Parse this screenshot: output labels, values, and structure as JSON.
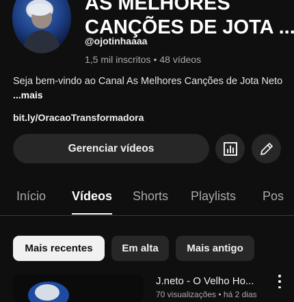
{
  "channel": {
    "title_line1": "AS MELHORES",
    "title_line2": "CANÇÕES DE JOTA ...",
    "handle": "@ojotinhaaaa",
    "subscribers": "1,5 mil inscritos",
    "separator": "•",
    "video_count": "48 vídeos",
    "description": "Seja bem-vindo ao Canal As Melhores Canções de Jota Neto",
    "more_label": "...mais",
    "link": "bit.ly/OracaoTransformadora"
  },
  "actions": {
    "manage_label": "Gerenciar vídeos",
    "analytics_icon": "analytics-icon",
    "edit_icon": "pencil-icon"
  },
  "tabs": [
    {
      "label": "Início"
    },
    {
      "label": "Vídeos",
      "active": true
    },
    {
      "label": "Shorts"
    },
    {
      "label": "Playlists"
    },
    {
      "label": "Pos"
    }
  ],
  "chips": [
    {
      "label": "Mais recentes",
      "selected": true
    },
    {
      "label": "Em alta"
    },
    {
      "label": "Mais antigo"
    }
  ],
  "video": {
    "title": "J.neto - O Velho Ho...",
    "meta": "70 visualizações • há 2 dias"
  },
  "colors": {
    "background": "#0f0f0f",
    "surface": "#272727",
    "text": "#f1f1f1",
    "secondary_text": "#aaaaaa"
  }
}
